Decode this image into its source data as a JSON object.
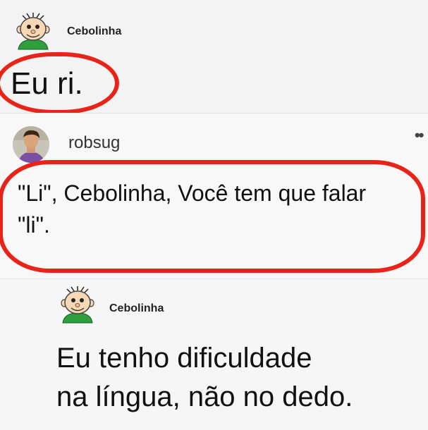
{
  "posts": [
    {
      "username": "Cebolinha",
      "text": "Eu ri.",
      "avatar": "cebolinha-avatar"
    },
    {
      "username": "robsug",
      "text_line1": "\"Li\", Cebolinha, Você tem que falar",
      "text_line2": "\"li\".",
      "avatar": "robsug-photo-avatar",
      "more_icon": "more-options-icon"
    },
    {
      "username": "Cebolinha",
      "text_line1": "Eu tenho dificuldade",
      "text_line2": "na língua, não no dedo.",
      "avatar": "cebolinha-avatar"
    }
  ],
  "colors": {
    "highlight": "#e8231a",
    "background": "#f3f3f3"
  }
}
